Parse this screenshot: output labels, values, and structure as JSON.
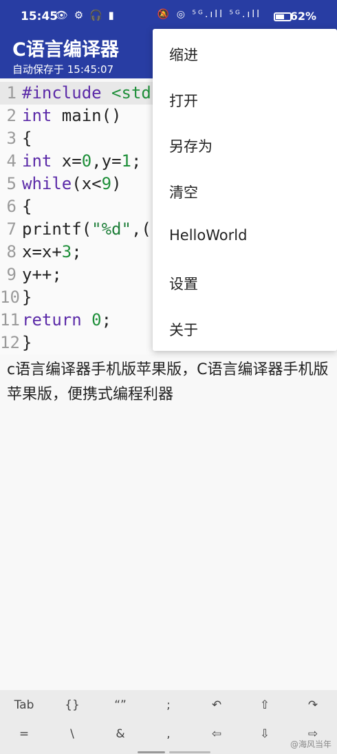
{
  "status_bar": {
    "time": "15:45",
    "icons_left": "👁 ⚙ 🎧 ▮",
    "icons_right": "🔕 ◎ ⁵ᴳ.ıll ⁵ᴳ.ıll",
    "battery_level": 0.62,
    "battery_text": "62%"
  },
  "header": {
    "title": "C语言编译器",
    "subtitle": "自动保存于 15:45:07"
  },
  "editor": {
    "lines": [
      {
        "n": "1",
        "segments": [
          {
            "t": "#include ",
            "c": "pre"
          },
          {
            "t": "<std",
            "c": "inc"
          }
        ]
      },
      {
        "n": "2",
        "segments": [
          {
            "t": "int",
            "c": "kw"
          },
          {
            "t": " main()",
            "c": ""
          }
        ]
      },
      {
        "n": "3",
        "segments": [
          {
            "t": "{",
            "c": ""
          }
        ]
      },
      {
        "n": "4",
        "segments": [
          {
            "t": "int",
            "c": "kw"
          },
          {
            "t": " x=",
            "c": ""
          },
          {
            "t": "0",
            "c": "num"
          },
          {
            "t": ",y=",
            "c": ""
          },
          {
            "t": "1",
            "c": "num"
          },
          {
            "t": ";",
            "c": ""
          }
        ]
      },
      {
        "n": "5",
        "segments": [
          {
            "t": "while",
            "c": "kw"
          },
          {
            "t": "(x<",
            "c": ""
          },
          {
            "t": "9",
            "c": "num"
          },
          {
            "t": ")",
            "c": ""
          }
        ]
      },
      {
        "n": "6",
        "segments": [
          {
            "t": "{",
            "c": ""
          }
        ]
      },
      {
        "n": "7",
        "segments": [
          {
            "t": "printf(",
            "c": ""
          },
          {
            "t": "\"%d\"",
            "c": "str"
          },
          {
            "t": ",(",
            "c": ""
          }
        ]
      },
      {
        "n": "8",
        "segments": [
          {
            "t": "x=x+",
            "c": ""
          },
          {
            "t": "3",
            "c": "num"
          },
          {
            "t": ";",
            "c": ""
          }
        ]
      },
      {
        "n": "9",
        "segments": [
          {
            "t": "y++;",
            "c": ""
          }
        ]
      },
      {
        "n": "10",
        "segments": [
          {
            "t": "}",
            "c": ""
          }
        ]
      },
      {
        "n": "11",
        "segments": [
          {
            "t": "return",
            "c": "kw"
          },
          {
            "t": " ",
            "c": ""
          },
          {
            "t": "0",
            "c": "num"
          },
          {
            "t": ";",
            "c": ""
          }
        ]
      },
      {
        "n": "12",
        "segments": [
          {
            "t": "}",
            "c": ""
          }
        ]
      }
    ]
  },
  "caption": "c语言编译器手机版苹果版，C语言编译器手机版苹果版，便携式编程利器",
  "menu": {
    "items": [
      "缩进",
      "打开",
      "另存为",
      "清空",
      "HelloWorld",
      "设置",
      "关于"
    ]
  },
  "extra_keys": {
    "row1": [
      {
        "label": "Tab",
        "icon": "tab-key"
      },
      {
        "label": "{}",
        "icon": "braces-key"
      },
      {
        "label": "“”",
        "icon": "quotes-key"
      },
      {
        "label": ";",
        "icon": "semicolon-key"
      },
      {
        "label": "↶",
        "icon": "undo-icon"
      },
      {
        "label": "⇧",
        "icon": "shift-up-icon"
      },
      {
        "label": "↷",
        "icon": "redo-icon"
      }
    ],
    "row2": [
      {
        "label": "=",
        "icon": "equals-key"
      },
      {
        "label": "\\",
        "icon": "backslash-key"
      },
      {
        "label": "&",
        "icon": "ampersand-key"
      },
      {
        "label": ",",
        "icon": "comma-key"
      },
      {
        "label": "⇦",
        "icon": "arrow-left-icon"
      },
      {
        "label": "⇩",
        "icon": "arrow-down-icon"
      },
      {
        "label": "⇨",
        "icon": "arrow-right-icon"
      }
    ]
  },
  "watermark": "@海风当年",
  "colors": {
    "header_bg": "#283da3",
    "keyword": "#5b2aa8",
    "number": "#1f8f3a"
  }
}
